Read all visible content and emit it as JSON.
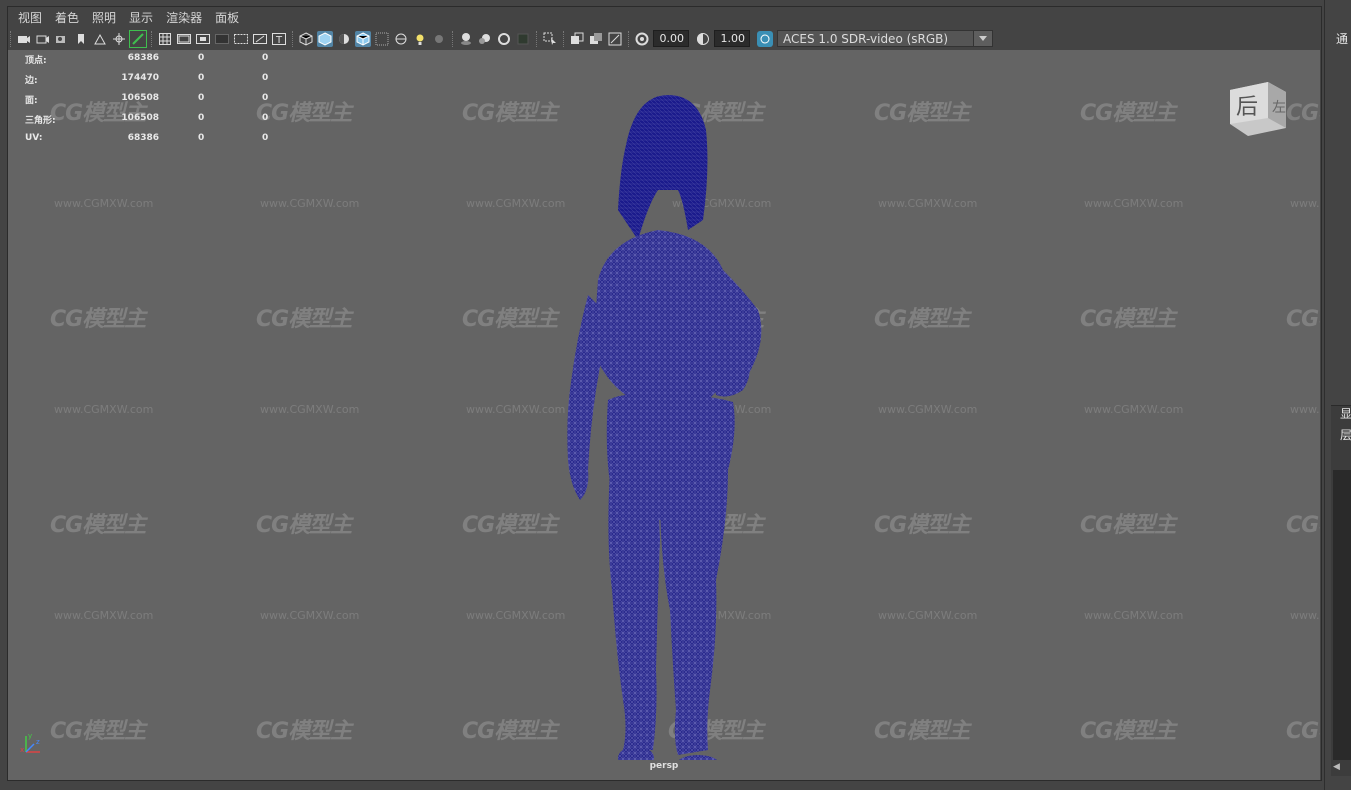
{
  "menubar": {
    "items": [
      "视图",
      "着色",
      "照明",
      "显示",
      "渲染器",
      "面板"
    ]
  },
  "toolbar": {
    "exposure": "0.00",
    "gamma": "1.00",
    "color_space": "ACES 1.0 SDR-video (sRGB)",
    "icons": [
      "camera-icon",
      "camera-attributes-icon",
      "camera-bookmark-icon",
      "bookmark-icon",
      "image-plane-icon",
      "pan-zoom-icon",
      "grease-pencil-icon",
      "grid-icon",
      "film-gate-icon",
      "resolution-gate-icon",
      "gate-mask-icon",
      "field-chart-icon",
      "safe-action-icon",
      "safe-title-icon",
      "wireframe-icon",
      "smooth-shade-icon",
      "default-material-icon",
      "wireframe-on-shaded-icon",
      "xray-icon",
      "xray-joints-icon",
      "use-lights-icon",
      "shadows-icon",
      "screen-space-ao-icon",
      "motion-blur-icon",
      "anti-aliasing-icon",
      "depth-of-field-icon",
      "isolate-select-icon",
      "xray-active-icon",
      "hud-icon",
      "heads-up-icon",
      "exposure-icon",
      "gamma-icon",
      "color-management-icon"
    ]
  },
  "hud": {
    "rows": [
      {
        "label": "顶点:",
        "v1": "68386",
        "v2": "0",
        "v3": "0"
      },
      {
        "label": "边:",
        "v1": "174470",
        "v2": "0",
        "v3": "0"
      },
      {
        "label": "面:",
        "v1": "106508",
        "v2": "0",
        "v3": "0"
      },
      {
        "label": "三角形:",
        "v1": "106508",
        "v2": "0",
        "v3": "0"
      },
      {
        "label": "UV:",
        "v1": "68386",
        "v2": "0",
        "v3": "0"
      }
    ]
  },
  "viewport": {
    "camera_label": "persp",
    "viewcube_label": "后",
    "viewcube_side_label": "左",
    "watermark_logo": "CG模型主",
    "watermark_url": "www.CGMXW.com",
    "background_color": "#646464",
    "wire_color": "#1a1a8c"
  },
  "right_panel": {
    "top_label": "通",
    "label_a": "显",
    "label_b": "层"
  },
  "axis": {
    "x": "x",
    "y": "y",
    "z": "z"
  }
}
